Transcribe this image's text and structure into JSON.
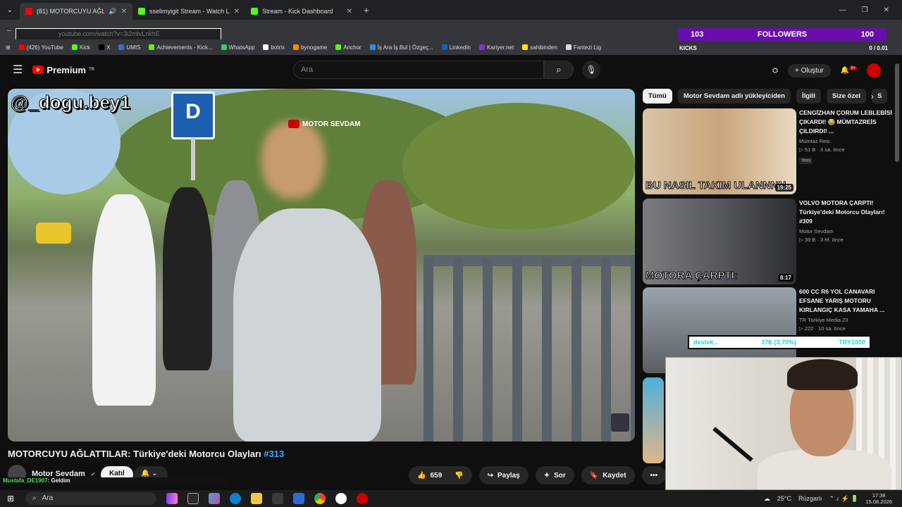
{
  "browser": {
    "tabs": [
      {
        "label": "(81) MOTORCUYU AĞLATTILA",
        "color": "#ff0000",
        "active": true
      },
      {
        "label": "sselimyigit Stream - Watch Live",
        "color": "#53fc18",
        "active": false
      },
      {
        "label": "Stream - Kick Dashboard",
        "color": "#53fc18",
        "active": false
      }
    ],
    "new_tab": "+",
    "url": "youtube.com/watch?v=3i2mlvLnkhE",
    "bookmarks": [
      {
        "label": "(426) YouTube",
        "color": "#ff0000"
      },
      {
        "label": "Kick",
        "color": "#53fc18"
      },
      {
        "label": "X",
        "color": "#000000"
      },
      {
        "label": "UMIS",
        "color": "#3a6fd8"
      },
      {
        "label": "Achievements - Kick...",
        "color": "#53fc18"
      },
      {
        "label": "WhatsApp",
        "color": "#25d366"
      },
      {
        "label": "botrix",
        "color": "#ffffff"
      },
      {
        "label": "bynogame",
        "color": "#ff8a00"
      },
      {
        "label": "Anchor",
        "color": "#53fc18"
      },
      {
        "label": "İş Ara İş Bul | Özgeç...",
        "color": "#1e90ff"
      },
      {
        "label": "LinkedIn",
        "color": "#0a66c2"
      },
      {
        "label": "Kariyer.net",
        "color": "#8a2be2"
      },
      {
        "label": "sahibinden",
        "color": "#ffe800"
      },
      {
        "label": "Fantezi Lig",
        "color": "#dddddd"
      }
    ]
  },
  "overlay": {
    "followers_left": "103",
    "followers_label": "FOLLOWERS",
    "followers_right": "100",
    "kicks_label": "KICKS",
    "kicks_value": "0 / 0.01",
    "donate_name": "destek...",
    "donate_progress": "37₺ (3,70%)",
    "donate_goal": "TRY1000"
  },
  "youtube": {
    "logo": "Premium",
    "logo_sup": "TR",
    "search_placeholder": "Ara",
    "create_label": "Oluştur",
    "notif_count": "9+",
    "video": {
      "handle": "@_dogu.bey1",
      "watermark": "MOTOR SEVDAM",
      "sign": "D",
      "title": "MOTORCUYU AĞLATTILAR: Türkiye'deki Motorcu Olayları ",
      "tag": "#313",
      "channel": "Motor Sevdam",
      "join": "Katıl",
      "likes": "659",
      "share": "Paylaş",
      "ask": "Sor",
      "save": "Kaydet",
      "more": "•••"
    },
    "chips": [
      "Tümü",
      "Motor Sevdam adlı yükleyiciden",
      "İlgili",
      "Size özel",
      "S"
    ],
    "recommendations": [
      {
        "title": "CENGİZHAN ÇORUM LEBLEBİSİ ÇIKARDI! 😂 MÜMTAZREİS ÇILDIRDI! ...",
        "channel": "Mümtaz Reis",
        "views": "▷ 51 B · 3 sa. önce",
        "badge": "Yeni",
        "duration": "19:25",
        "thumb_text": "BU NASIL TAKIM ULANNNN"
      },
      {
        "title": "VOLVO MOTORA ÇARPTI! Türkiye'deki Motorcu Olayları! #309",
        "channel": "Motor Sevdam",
        "views": "▷ 39 B · 3 hf. önce",
        "badge": "",
        "duration": "8:17",
        "thumb_text": "MOTORA ÇARPTI:"
      },
      {
        "title": "600 CC R6 YOL CANAVARI EFSANE YARIŞ MOTORU KIRLANGIÇ KASA YAMAHA ...",
        "channel": "TR Türkiye Media 23",
        "views": "▷ 222 · 10 sa. önce",
        "badge": "",
        "duration": "",
        "thumb_text": ""
      }
    ]
  },
  "chat": {
    "user": "Mustafa_DE1907",
    "message": ": Geldim"
  },
  "taskbar": {
    "search": "Ara",
    "weather": "25°C",
    "weather_label": "Rüzgarlı",
    "time": "17:38",
    "date": "15.08.2026"
  }
}
